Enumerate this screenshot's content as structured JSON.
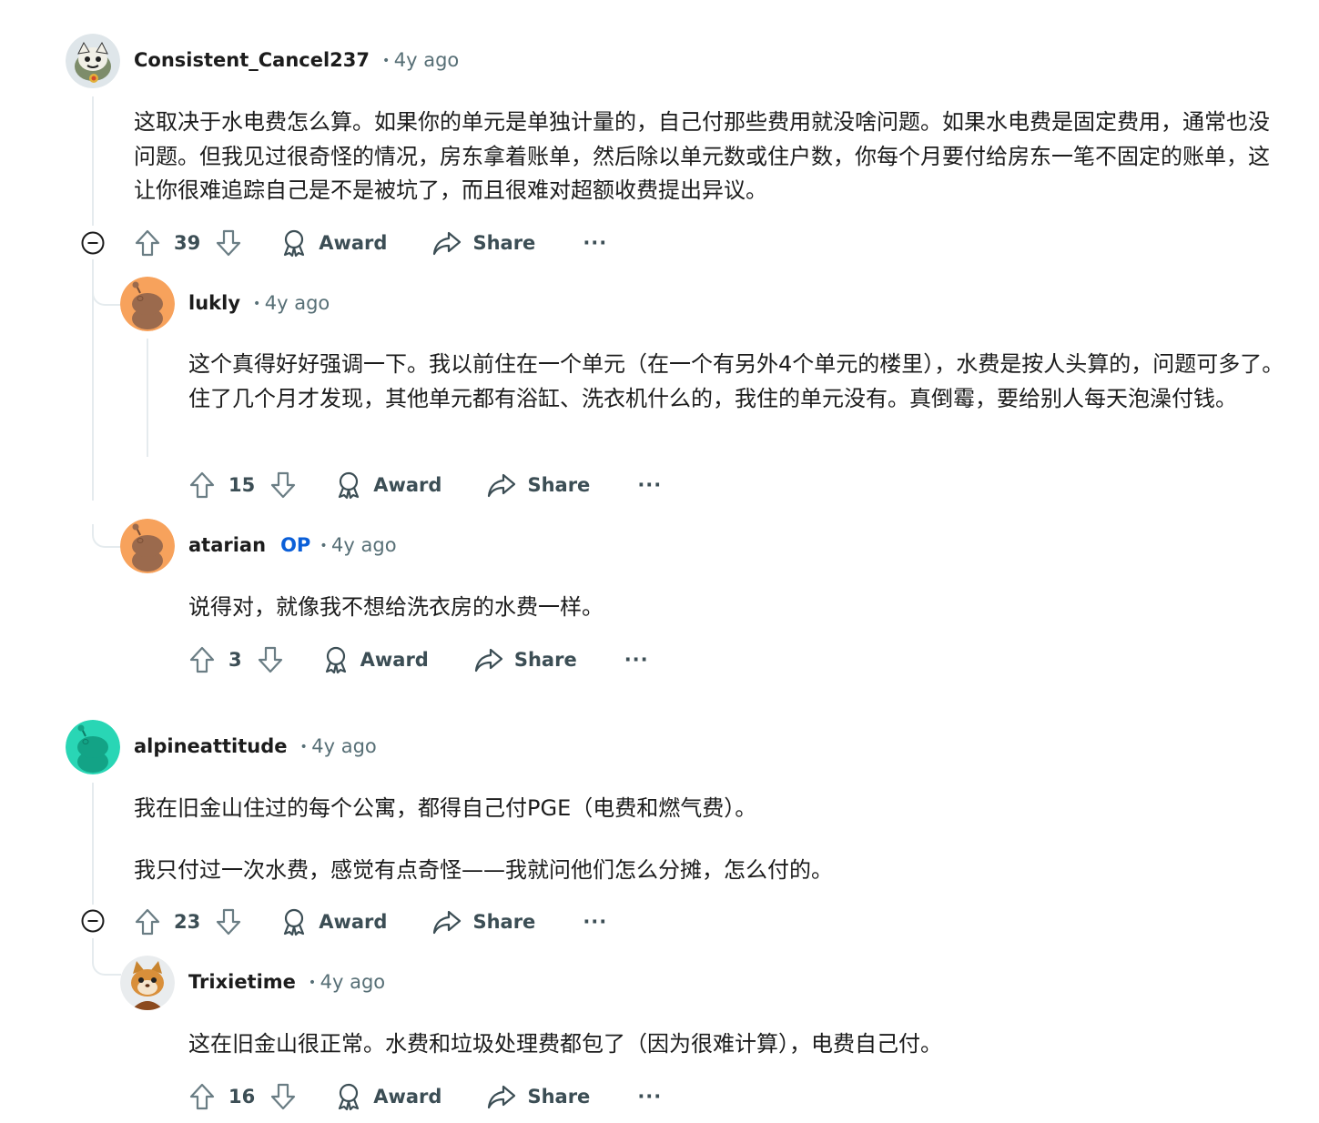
{
  "comments": [
    {
      "username": "Consistent_Cancel237",
      "time": "4y ago",
      "avatar": "snoo-costume-avatar",
      "body": [
        "这取决于水电费怎么算。如果你的单元是单独计量的，自己付那些费用就没啥问题。如果水电费是固定费用，通常也没问题。但我见过很奇怪的情况，房东拿着账单，然后除以单元数或住户数，你每个月要付给房东一笔不固定的账单，这让你很难追踪自己是不是被坑了，而且很难对超额收费提出异议。"
      ],
      "votes": "39",
      "award_label": "Award",
      "share_label": "Share",
      "more_label": "···"
    },
    {
      "username": "lukly",
      "time": "4y ago",
      "avatar": "snoo-orange-avatar",
      "body": [
        "这个真得好好强调一下。我以前住在一个单元（在一个有另外4个单元的楼里），水费是按人头算的，问题可多了。住了几个月才发现，其他单元都有浴缸、洗衣机什么的，我住的单元没有。真倒霉，要给别人每天泡澡付钱。"
      ],
      "votes": "15",
      "award_label": "Award",
      "share_label": "Share",
      "more_label": "···"
    },
    {
      "username": "atarian",
      "op_label": "OP",
      "time": "4y ago",
      "avatar": "snoo-orange-avatar",
      "body": [
        "说得对，就像我不想给洗衣房的水费一样。"
      ],
      "votes": "3",
      "award_label": "Award",
      "share_label": "Share",
      "more_label": "···"
    },
    {
      "username": "alpineattitude",
      "time": "4y ago",
      "avatar": "snoo-teal-avatar",
      "body": [
        "我在旧金山住过的每个公寓，都得自己付PGE（电费和燃气费）。",
        "我只付过一次水费，感觉有点奇怪——我就问他们怎么分摊，怎么付的。"
      ],
      "votes": "23",
      "award_label": "Award",
      "share_label": "Share",
      "more_label": "···"
    },
    {
      "username": "Trixietime",
      "time": "4y ago",
      "avatar": "snoo-cat-costume-avatar",
      "body": [
        "这在旧金山很正常。水费和垃圾处理费都包了（因为很难计算），电费自己付。"
      ],
      "votes": "16",
      "award_label": "Award",
      "share_label": "Share",
      "more_label": "···"
    }
  ],
  "colors": {
    "op": "#0b5fd8",
    "meta": "#576f76",
    "action": "#3c4e55",
    "thread_line": "#e5ebee",
    "avatar_orange": "#f7a25c",
    "avatar_teal": "#29d6b5"
  }
}
